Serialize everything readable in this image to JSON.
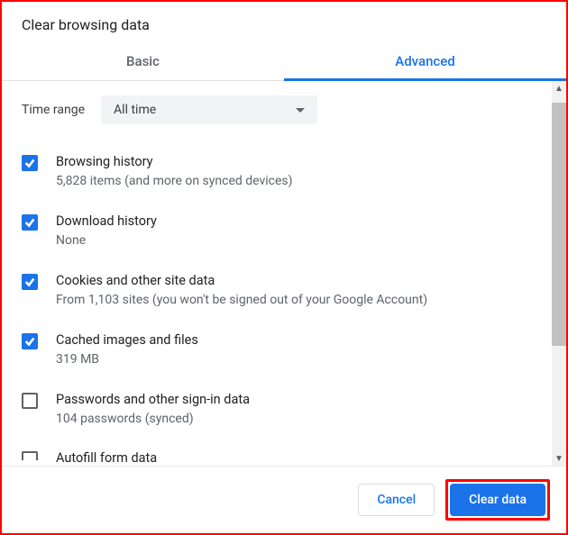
{
  "dialog": {
    "title": "Clear browsing data"
  },
  "tabs": {
    "basic": "Basic",
    "advanced": "Advanced"
  },
  "time": {
    "label": "Time range",
    "value": "All time"
  },
  "items": [
    {
      "title": "Browsing history",
      "sub": "5,828 items (and more on synced devices)",
      "checked": true
    },
    {
      "title": "Download history",
      "sub": "None",
      "checked": true
    },
    {
      "title": "Cookies and other site data",
      "sub": "From 1,103 sites (you won't be signed out of your Google Account)",
      "checked": true
    },
    {
      "title": "Cached images and files",
      "sub": "319 MB",
      "checked": true
    },
    {
      "title": "Passwords and other sign-in data",
      "sub": "104 passwords (synced)",
      "checked": false
    },
    {
      "title": "Autofill form data",
      "sub": "",
      "checked": false
    }
  ],
  "footer": {
    "cancel": "Cancel",
    "clear": "Clear data"
  }
}
